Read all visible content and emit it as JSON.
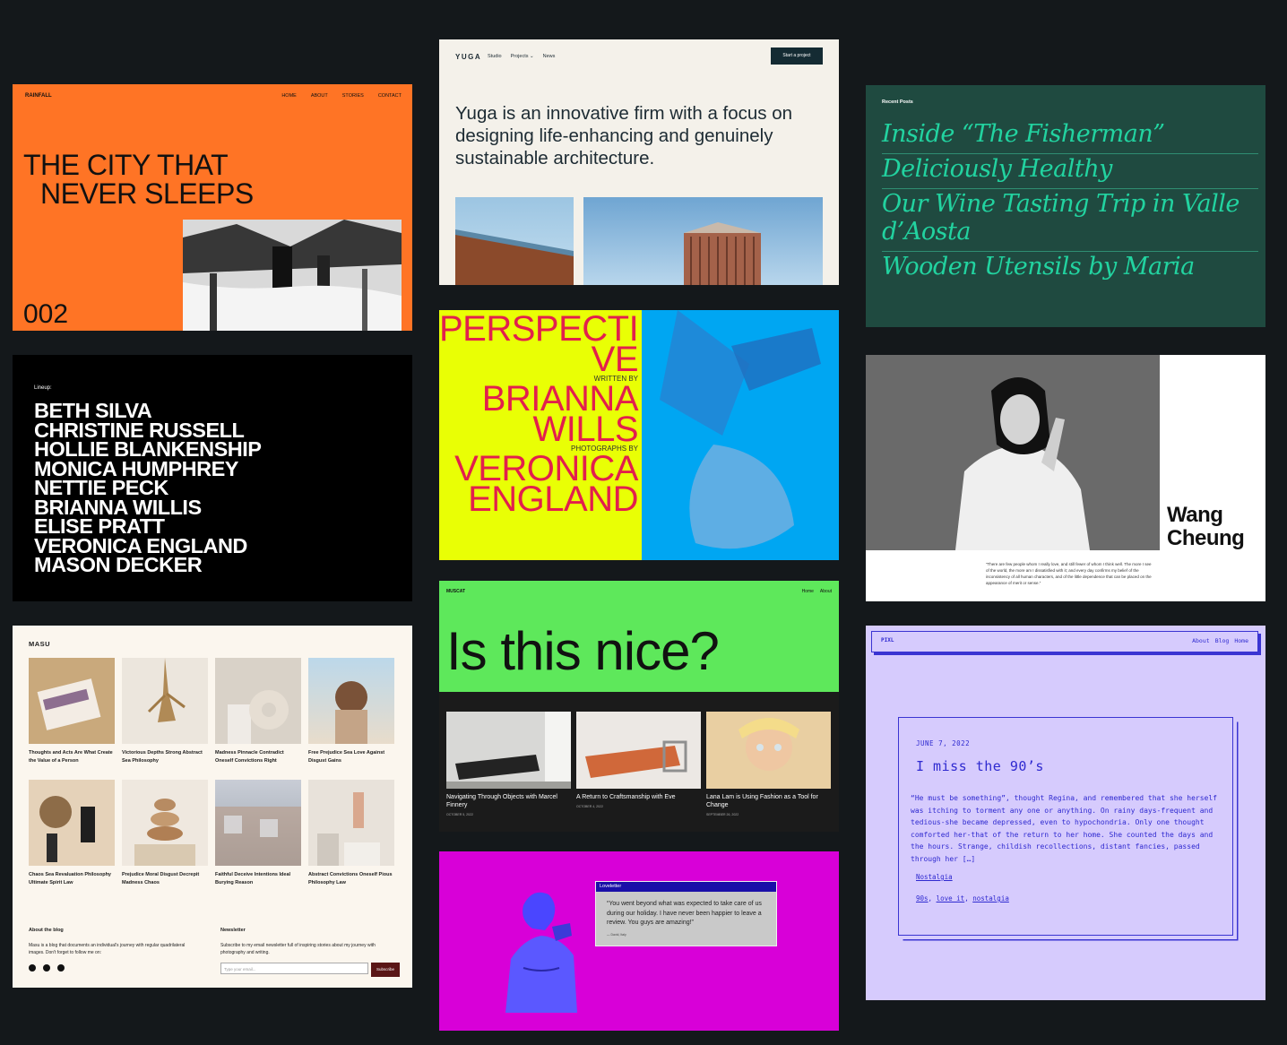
{
  "rainfall": {
    "brand": "RAINFALL",
    "nav": [
      "HOME",
      "ABOUT",
      "STORIES",
      "CONTACT"
    ],
    "headline_1": "THE CITY THAT",
    "headline_2": "NEVER SLEEPS",
    "issue": "002"
  },
  "lineup": {
    "label": "Lineup:",
    "names": [
      "BETH SILVA",
      "CHRISTINE RUSSELL",
      "HOLLIE BLANKENSHIP",
      "MONICA HUMPHREY",
      "NETTIE PECK",
      "BRIANNA WILLIS",
      "ELISE PRATT",
      "VERONICA ENGLAND",
      "MASON DECKER"
    ]
  },
  "masu": {
    "brand": "MASU",
    "posts": [
      "Thoughts and Acts Are What Create the Value of a Person",
      "Victorious Depths Strong Abstract Sea Philosophy",
      "Madness Pinnacle Contradict Oneself Convictions Right",
      "Free Prejudice Sea Love Against Disgust Gains",
      "Chaos Sea Revaluation Philosophy Ultimate Spirit Law",
      "Prejudice Moral Disgust Decrepit Madness Chaos",
      "Faithful Deceive Intentions Ideal Burying Reason",
      "Abstract Convictions Oneself Pious Philosophy Law"
    ],
    "about_title": "About the blog",
    "about_text": "Masu is a blog that documents an individual's journey with regular quadrilateral images. Don't forget to follow me on:",
    "news_title": "Newsletter",
    "news_text": "Subscribe to my email newsletter full of inspiring stories about my journey with photography and writing.",
    "email_placeholder": "Type your email...",
    "subscribe": "Subscribe"
  },
  "yuga": {
    "brand": "YUGA",
    "nav": [
      "Studio",
      "Projects ⌄",
      "News"
    ],
    "cta": "Start a project",
    "lead": "Yuga is an innovative firm with a focus on designing life-enhancing and genuinely sustainable architecture."
  },
  "perspective": {
    "title_1": "PERSPECTI",
    "title_2": "VE",
    "written_by": "WRITTEN BY",
    "author_1": "BRIANNA",
    "author_2": "WILLS",
    "photos_by": "PHOTOGRAPHS BY",
    "photographer_1": "VERONICA",
    "photographer_2": "ENGLAND"
  },
  "muscat": {
    "brand": "MUSCAT",
    "nav": [
      "Home",
      "About"
    ],
    "headline": "Is this nice?",
    "posts": [
      {
        "title": "Navigating Through Objects with Marcel Finnery",
        "date": "OCTOBER 5, 2022"
      },
      {
        "title": "A Return to Craftsmanship with Eve",
        "date": "OCTOBER 4, 2022"
      },
      {
        "title": "Lana Lam is Using Fashion as a Tool for Change",
        "date": "SEPTEMBER 26, 2022"
      }
    ]
  },
  "loveletter": {
    "header": "Loveletter",
    "quote": "“You went beyond what was expected to take care of us during our holiday. I have never been happier to leave a review. You guys are amazing!”",
    "by": "— David, Italy"
  },
  "recent": {
    "label": "Recent Posts",
    "posts": [
      "Inside “The Fisherman”",
      "Deliciously Healthy",
      "Our Wine Tasting Trip in Valle d’Aosta",
      "Wooden Utensils by Maria"
    ]
  },
  "wang": {
    "name_1": "Wang",
    "name_2": "Cheung",
    "quote": "“There are few people whom I really love, and still fewer of whom I think well. The more I see of the world, the more am I dissatisfied with it; and every day confirms my belief of the inconsistency of all human characters, and of the little dependence that can be placed on the appearance of merit or sense.”"
  },
  "pixl": {
    "brand": "PIXL",
    "nav": [
      "About",
      "Blog",
      "Home"
    ],
    "date": "JUNE 7, 2022",
    "title": "I miss the 90’s",
    "excerpt": "“He must be something”, thought Regina, and remembered that she herself was itching to torment any one or anything. On rainy days-frequent and tedious-she became depressed, even to hypochondria. Only one thought comforted her-that of the return to her home. She counted the days and the hours. Strange, childish recollections, distant fancies, passed through her […]",
    "category": "Nostalgia",
    "tags": [
      "90s",
      "love it",
      "nostalgia"
    ]
  }
}
